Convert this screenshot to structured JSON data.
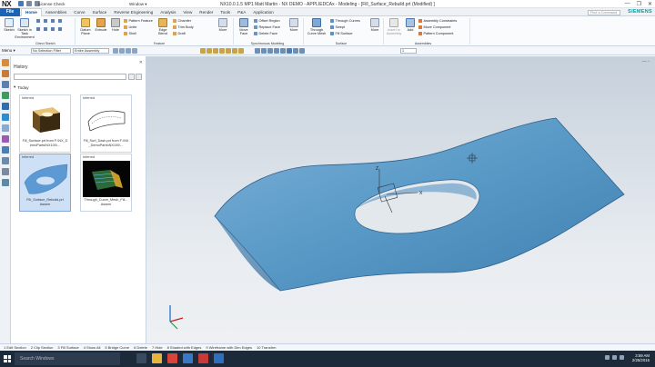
{
  "titlebar": {
    "logo": "NX",
    "license": "License Check",
    "window_menu": "Window ▾",
    "title": "NX10.0.1.5 MP1 Matt Martin - NX DEMO - APPLIEDCAx - Modeling - [Fill_Surface_Rebuild.prt (Modified) ]",
    "controls": [
      "—",
      "❐",
      "✕"
    ]
  },
  "tabs": {
    "file": "File",
    "items": [
      "Home",
      "Assemblies",
      "Curve",
      "Surface",
      "Reverse Engineering",
      "Analysis",
      "View",
      "Render",
      "Tools",
      "P&A",
      "Application"
    ],
    "active": "Home",
    "search_placeholder": "Find a Command",
    "brand": "SIEMENS"
  },
  "ribbon": {
    "direct_sketch": {
      "sketch": "Sketch",
      "sketch_in_task": "Sketch in Task Environment",
      "label": "Direct Sketch"
    },
    "feature": {
      "datum_plane": "Datum Plane",
      "extrude": "Extrude",
      "hole": "Hole",
      "pattern_feature": "Pattern Feature",
      "unite": "Unite",
      "shell": "Shell",
      "edge_blend": "Edge Blend",
      "chamfer": "Chamfer",
      "trim_body": "Trim Body",
      "draft": "Draft",
      "more": "More",
      "label": "Feature"
    },
    "sync": {
      "move_face": "Move Face",
      "offset_region": "Offset Region",
      "replace_face": "Replace Face",
      "delete_face": "Delete Face",
      "more": "More",
      "label": "Synchronous Modeling"
    },
    "surface": {
      "through_curve_mesh": "Through Curve Mesh",
      "through_curves": "Through Curves",
      "swept": "Swept",
      "fill_surface": "Fill Surface",
      "more": "More",
      "label": "Surface"
    },
    "assemblies": {
      "insert_in_assembly": "Insert in Assembly",
      "add": "Add",
      "assembly_constraints": "Assembly Constraints",
      "move_component": "Move Component",
      "pattern_component": "Pattern Component",
      "label": "Assemblies"
    }
  },
  "selbar": {
    "menu": "Menu ▾",
    "filter": "No Selection Filter",
    "scope": "Entire Assembly",
    "scope2": "1"
  },
  "history": {
    "title": "History",
    "group": "Today",
    "cards": [
      {
        "label": "Inferred",
        "text": "Fill_Surface.prt from F:\\NX_DemoParts\\NX100\\...",
        "selected": false
      },
      {
        "label": "Inferred",
        "text": "Fill_Surf_Dash.prt from F:\\NX_DemoParts\\NX100\\...",
        "selected": false
      },
      {
        "label": "Inferred",
        "text": "Fill_Surface_Rebuild.prt",
        "sub": "Assem",
        "selected": true
      },
      {
        "label": "Inferred",
        "text": "Through_Curve_Mesh_Fill...",
        "sub": "Assem",
        "selected": false
      }
    ]
  },
  "cue": {
    "items": [
      "1 Edit Section",
      "2 Clip Section",
      "3 Fill Surface",
      "4 Show All",
      "5 Bridge Curve",
      "6 Delete",
      "7 Hide",
      "8 Shaded with Edges",
      "9 Wireframe with Dim Edges",
      "10 Transfrm"
    ]
  },
  "taskbar": {
    "search_placeholder": "Search Windows",
    "time": "3:59 AM",
    "date": "2/25/2016"
  },
  "colors": {
    "file_tab": "#1a63b6",
    "surface": "#5b9bc8",
    "brand": "#079d9d"
  }
}
